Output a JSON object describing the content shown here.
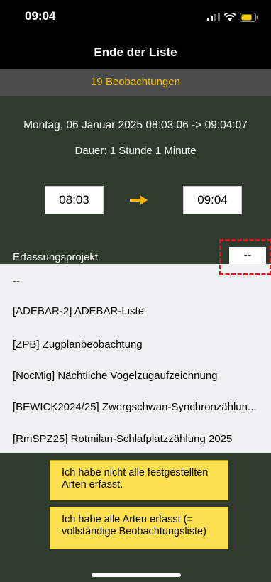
{
  "status_bar": {
    "time": "09:04",
    "icons": [
      "signal-icon",
      "wifi-icon",
      "battery-icon"
    ]
  },
  "nav": {
    "title": "Ende der Liste"
  },
  "count": {
    "text": "19 Beobachtungen",
    "color": "#f4c20d"
  },
  "session": {
    "date_range": "Montag, 06 Januar 2025 08:03:06 -> 09:04:07",
    "duration": "Dauer: 1 Stunde 1 Minute",
    "start_time": "08:03",
    "end_time": "09:04"
  },
  "project": {
    "label": "Erfassungsprojekt",
    "selected": "--"
  },
  "dropdown": {
    "options": [
      "--",
      "[ADEBAR-2] ADEBAR-Liste",
      "[ZPB] Zugplanbeobachtung",
      "[NocMig] Nächtliche Vogelzugaufzeichnung",
      "[BEWICK2024/25] Zwergschwan-Synchronzählun...",
      "[RmSPZ25] Rotmilan-Schlafplatzzählung 2025"
    ]
  },
  "actions": {
    "partial_label": "Ich habe nicht alle festgestellten Arten erfasst.",
    "complete_label": "Ich habe alle Arten erfasst (= vollständige Beobachtungsliste)"
  },
  "colors": {
    "background": "#2f3b2f",
    "accent": "#f4c20d",
    "button": "#fce050",
    "highlight": "#e0141e"
  }
}
